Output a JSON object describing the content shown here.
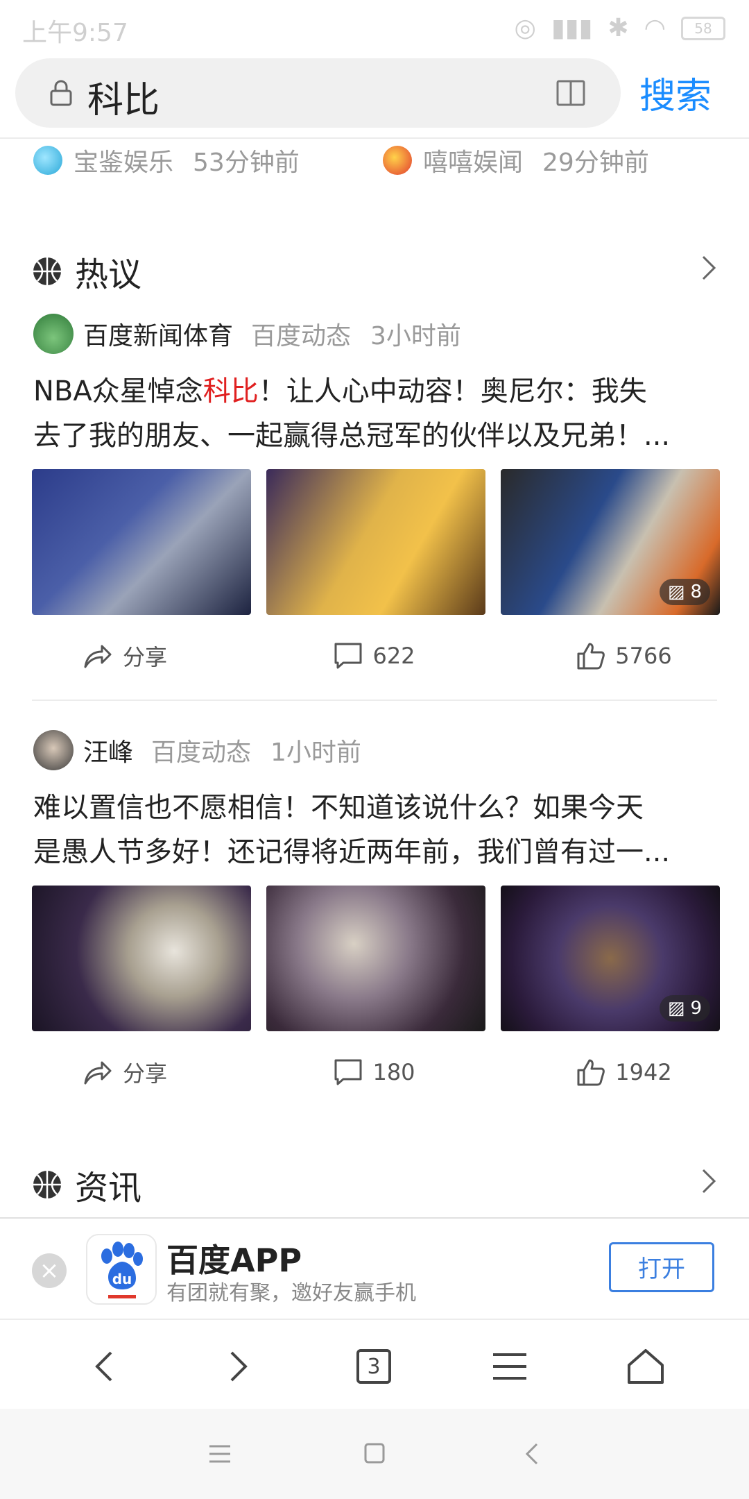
{
  "status_bar": {
    "time": "上午9:57",
    "battery": "58"
  },
  "search": {
    "query": "科比",
    "search_label": "搜索"
  },
  "sources": [
    {
      "name": "宝鉴娱乐",
      "time": "53分钟前"
    },
    {
      "name": "嘻嘻娱闻",
      "time": "29分钟前"
    }
  ],
  "sections": {
    "hot": "热议",
    "news": "资讯"
  },
  "posts": [
    {
      "author": "百度新闻体育",
      "type": "百度动态",
      "time": "3小时前",
      "text_pre": "NBA众星悼念",
      "text_hl": "科比",
      "text_post": "！让人心中动容！奥尼尔：我失",
      "text_line2": "去了我的朋友、一起赢得总冠军的伙伴以及兄弟！...",
      "image_count": "8",
      "share_label": "分享",
      "comments": "622",
      "likes": "5766"
    },
    {
      "author": "汪峰",
      "type": "百度动态",
      "time": "1小时前",
      "text_line1": "难以置信也不愿相信！不知道该说什么？如果今天",
      "text_line2": "是愚人节多好！还记得将近两年前，我们曾有过一...",
      "image_count": "9",
      "share_label": "分享",
      "comments": "180",
      "likes": "1942"
    }
  ],
  "banner": {
    "app_name": "百度APP",
    "desc": "有团就有聚，邀好友赢手机",
    "open_label": "打开",
    "tab_count": "3"
  },
  "colors": {
    "accent": "#1a8cff",
    "highlight": "#e02020",
    "open_button": "#3b7fe0"
  }
}
